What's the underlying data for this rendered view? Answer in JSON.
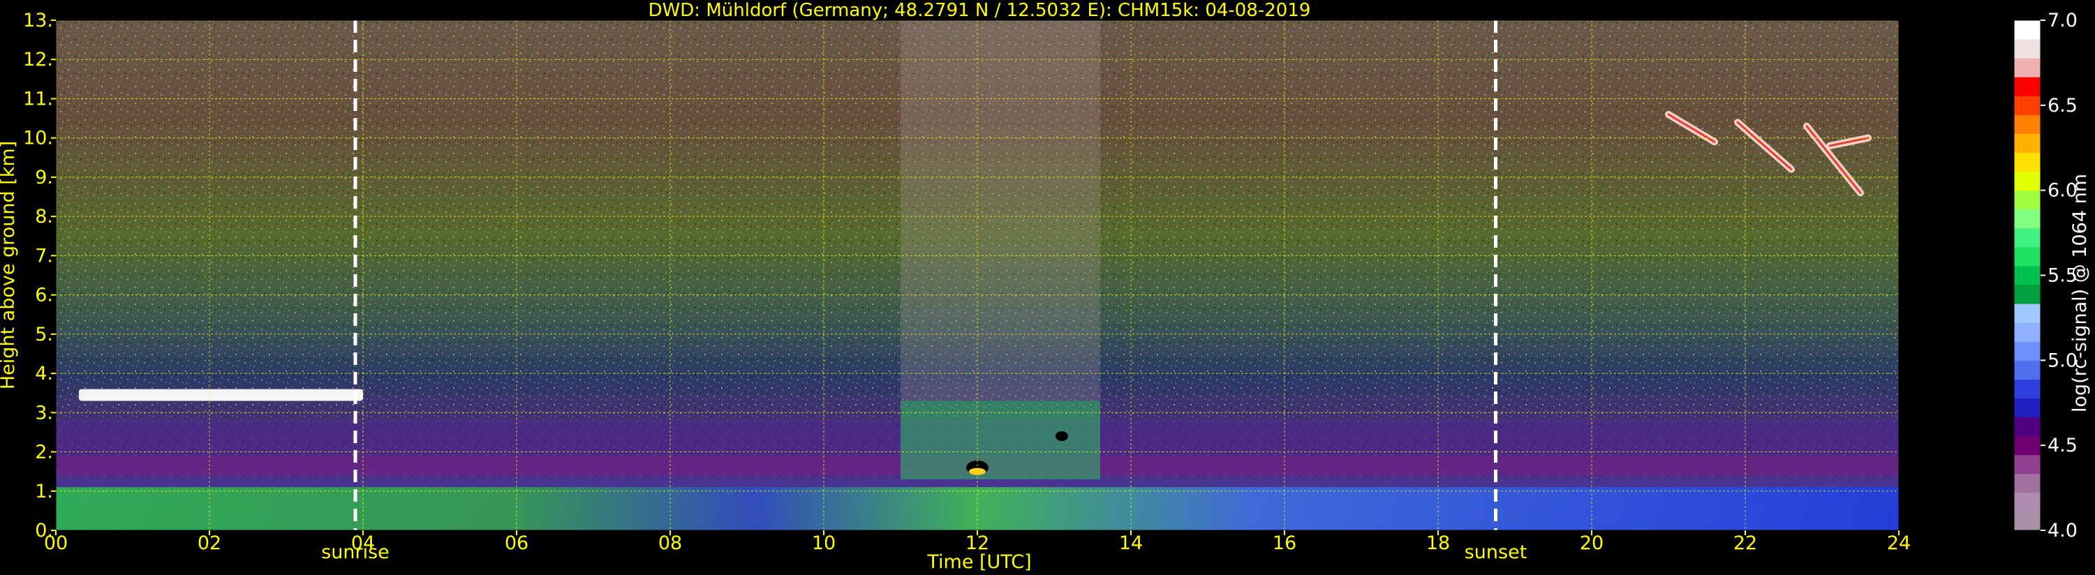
{
  "chart_data": {
    "type": "heatmap",
    "title": "DWD: Mühldorf (Germany; 48.2791 N / 12.5032 E):    CHM15k: 04-08-2019",
    "xlabel": "Time [UTC]",
    "ylabel": "Height above ground [km]",
    "xlim": [
      0,
      24
    ],
    "ylim": [
      0,
      13
    ],
    "x_ticks": [
      "00",
      "02",
      "04",
      "06",
      "08",
      "10",
      "12",
      "14",
      "16",
      "18",
      "20",
      "22",
      "24"
    ],
    "y_ticks": [
      "0.",
      "1.",
      "2.",
      "3.",
      "4.",
      "5.",
      "6.",
      "7.",
      "8.",
      "9.",
      "10.",
      "11.",
      "12.",
      "13."
    ],
    "grid": true,
    "colorbar": {
      "label": "log(rc-signal) @ 1064 nm",
      "range": [
        4.0,
        7.0
      ],
      "ticks": [
        "4.0",
        "4.5",
        "5.0",
        "5.5",
        "6.0",
        "6.5",
        "7.0"
      ],
      "colors": [
        "#a890a8",
        "#b08cb0",
        "#a070a0",
        "#904090",
        "#700070",
        "#500080",
        "#2020c0",
        "#3040e0",
        "#5070f0",
        "#7090ff",
        "#90b0ff",
        "#a0c8ff",
        "#00a040",
        "#00c050",
        "#20e060",
        "#40f080",
        "#80ff80",
        "#a0ff40",
        "#e0ff00",
        "#ffe000",
        "#ffb000",
        "#ff8000",
        "#ff4000",
        "#ff0000",
        "#f0b0b0",
        "#f0e0e0",
        "#ffffff"
      ]
    },
    "events": [
      {
        "name": "sunrise",
        "x": 3.9
      },
      {
        "name": "sunset",
        "x": 18.75
      }
    ],
    "features": [
      {
        "name": "aerosol-layer",
        "x_range": [
          0,
          24
        ],
        "y_range": [
          0,
          2.8
        ]
      },
      {
        "name": "low-cloud-layer",
        "x_range": [
          0.3,
          4.0
        ],
        "y_range": [
          3.3,
          3.6
        ]
      },
      {
        "name": "cumulus-clouds",
        "x_range": [
          11.0,
          13.6
        ],
        "y_range": [
          1.3,
          3.3
        ]
      },
      {
        "name": "cirrus-clouds",
        "x_range": [
          21.0,
          23.5
        ],
        "y_range": [
          8.5,
          10.7
        ]
      }
    ]
  }
}
